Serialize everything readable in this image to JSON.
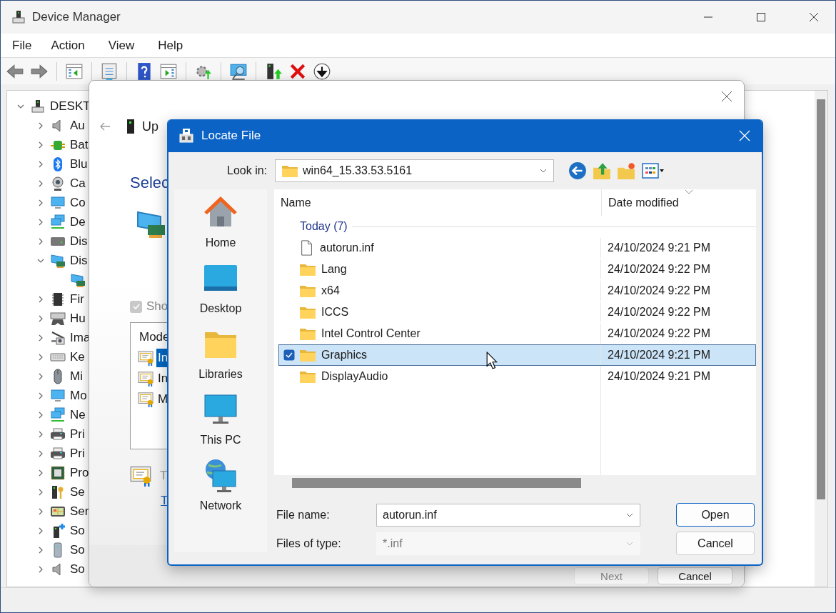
{
  "window": {
    "title": "Device Manager"
  },
  "menu": [
    "File",
    "Action",
    "View",
    "Help"
  ],
  "tree": {
    "label": "DESKT",
    "expanded": true,
    "children": [
      {
        "label": "Au",
        "expanded": false
      },
      {
        "label": "Bat",
        "expanded": false
      },
      {
        "label": "Blu",
        "expanded": false
      },
      {
        "label": "Ca",
        "expanded": false
      },
      {
        "label": "Co",
        "expanded": false
      },
      {
        "label": "De",
        "expanded": false
      },
      {
        "label": "Dis",
        "expanded": false
      },
      {
        "label": "Dis",
        "expanded": true,
        "children": [
          {
            "kind": "device"
          }
        ]
      },
      {
        "label": "Fir",
        "expanded": false
      },
      {
        "label": "Hu",
        "expanded": false
      },
      {
        "label": "Ima",
        "expanded": false
      },
      {
        "label": "Ke",
        "expanded": false
      },
      {
        "label": "Mi",
        "expanded": false
      },
      {
        "label": "Mo",
        "expanded": false
      },
      {
        "label": "Ne",
        "expanded": false
      },
      {
        "label": "Pri",
        "expanded": false
      },
      {
        "label": "Pri",
        "expanded": false
      },
      {
        "label": "Pro",
        "expanded": false
      },
      {
        "label": "Se",
        "expanded": false
      },
      {
        "label": "Ser",
        "expanded": false
      },
      {
        "label": "So",
        "expanded": false
      },
      {
        "label": "So",
        "expanded": false
      },
      {
        "label": "So",
        "expanded": false
      }
    ]
  },
  "wizard": {
    "title": "Up",
    "heading": "Selec",
    "show_compatible": {
      "label": "Sho",
      "checked": true,
      "disabled": true
    },
    "list": {
      "header": "Mode",
      "items": [
        {
          "label": "In",
          "selected": true
        },
        {
          "label": "In",
          "selected": false
        },
        {
          "label": "M",
          "selected": false
        }
      ]
    },
    "note": "T",
    "link": "T",
    "buttons": [
      {
        "label": "Next",
        "disabled": true
      },
      {
        "label": "Cancel",
        "disabled": false
      }
    ]
  },
  "locate": {
    "title": "Locate File",
    "look_in": {
      "label": "Look in:",
      "value": "win64_15.33.53.5161"
    },
    "places": [
      "Home",
      "Desktop",
      "Libraries",
      "This PC",
      "Network"
    ],
    "columns": [
      "Name",
      "Date modified"
    ],
    "group": "Today (7)",
    "rows": [
      {
        "kind": "file",
        "name": "autorun.inf",
        "date": "24/10/2024 9:21 PM",
        "selected": false
      },
      {
        "kind": "folder",
        "name": "Lang",
        "date": "24/10/2024 9:22 PM",
        "selected": false
      },
      {
        "kind": "folder",
        "name": "x64",
        "date": "24/10/2024 9:22 PM",
        "selected": false
      },
      {
        "kind": "folder",
        "name": "ICCS",
        "date": "24/10/2024 9:22 PM",
        "selected": false
      },
      {
        "kind": "folder",
        "name": "Intel Control Center",
        "date": "24/10/2024 9:22 PM",
        "selected": false
      },
      {
        "kind": "folder",
        "name": "Graphics",
        "date": "24/10/2024 9:21 PM",
        "selected": true
      },
      {
        "kind": "folder",
        "name": "DisplayAudio",
        "date": "24/10/2024 9:21 PM",
        "selected": false
      }
    ],
    "file_name": {
      "label": "File name:",
      "value": "autorun.inf"
    },
    "file_type": {
      "label": "Files of type:",
      "value": "*.inf",
      "disabled": true
    },
    "buttons": [
      {
        "label": "Open",
        "default": true
      },
      {
        "label": "Cancel",
        "default": false
      }
    ]
  }
}
